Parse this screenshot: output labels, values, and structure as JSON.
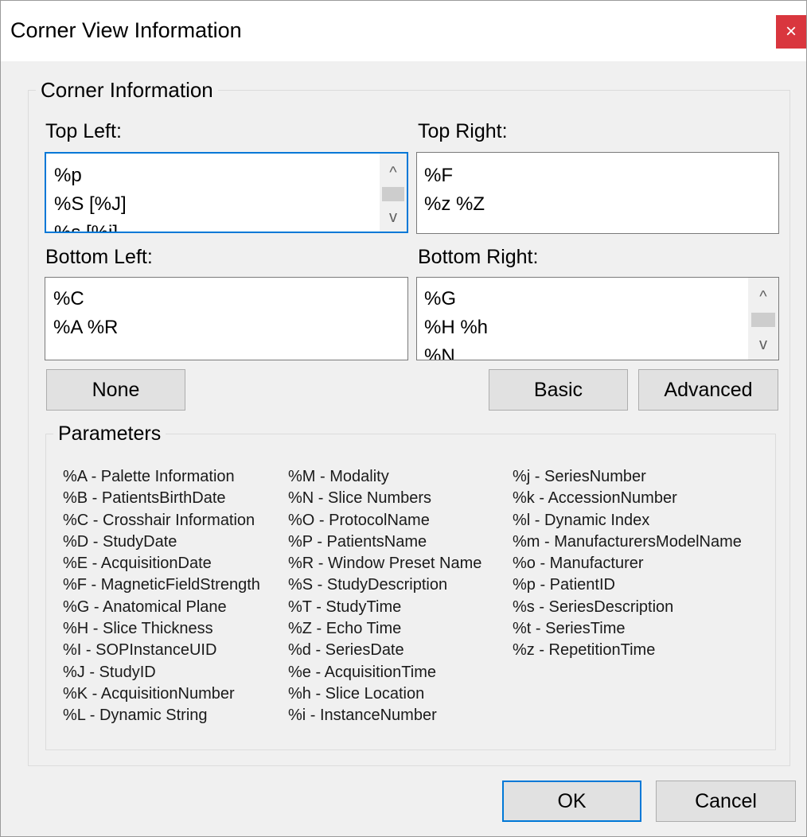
{
  "window": {
    "title": "Corner View Information",
    "close_glyph": "×",
    "close_color": "#d9363e"
  },
  "corner_group": {
    "label": "Corner Information"
  },
  "top_left": {
    "label": "Top Left:",
    "lines": [
      "%p",
      "%S [%J]",
      "%s [%i]"
    ]
  },
  "top_right": {
    "label": "Top Right:",
    "lines": [
      "%F",
      "%z %Z"
    ]
  },
  "bottom_left": {
    "label": "Bottom Left:",
    "lines": [
      "%C",
      "%A %R"
    ]
  },
  "bottom_right": {
    "label": "Bottom Right:",
    "lines": [
      "%G",
      "%H %h",
      "%N"
    ]
  },
  "scroll": {
    "up_glyph": "^",
    "down_glyph": "v"
  },
  "buttons": {
    "none": "None",
    "basic": "Basic",
    "advanced": "Advanced",
    "ok": "OK",
    "cancel": "Cancel"
  },
  "accent_color": "#0078d7",
  "parameters": {
    "label": "Parameters",
    "columns": [
      [
        "%A - Palette Information",
        "%B - PatientsBirthDate",
        "%C - Crosshair Information",
        "%D - StudyDate",
        "%E - AcquisitionDate",
        "%F - MagneticFieldStrength",
        "%G - Anatomical Plane",
        "%H - Slice Thickness",
        "%I - SOPInstanceUID",
        "%J - StudyID",
        "%K - AcquisitionNumber",
        "%L - Dynamic String"
      ],
      [
        "%M - Modality",
        "%N - Slice Numbers",
        "%O - ProtocolName",
        "%P - PatientsName",
        "%R - Window Preset Name",
        "%S - StudyDescription",
        "%T - StudyTime",
        "%Z - Echo Time",
        "%d - SeriesDate",
        "%e - AcquisitionTime",
        "%h - Slice Location",
        "%i - InstanceNumber"
      ],
      [
        "%j - SeriesNumber",
        "%k - AccessionNumber",
        "%l - Dynamic Index",
        "%m - ManufacturersModelName",
        "%o - Manufacturer",
        "%p - PatientID",
        "%s - SeriesDescription",
        "%t - SeriesTime",
        "%z - RepetitionTime"
      ]
    ]
  }
}
